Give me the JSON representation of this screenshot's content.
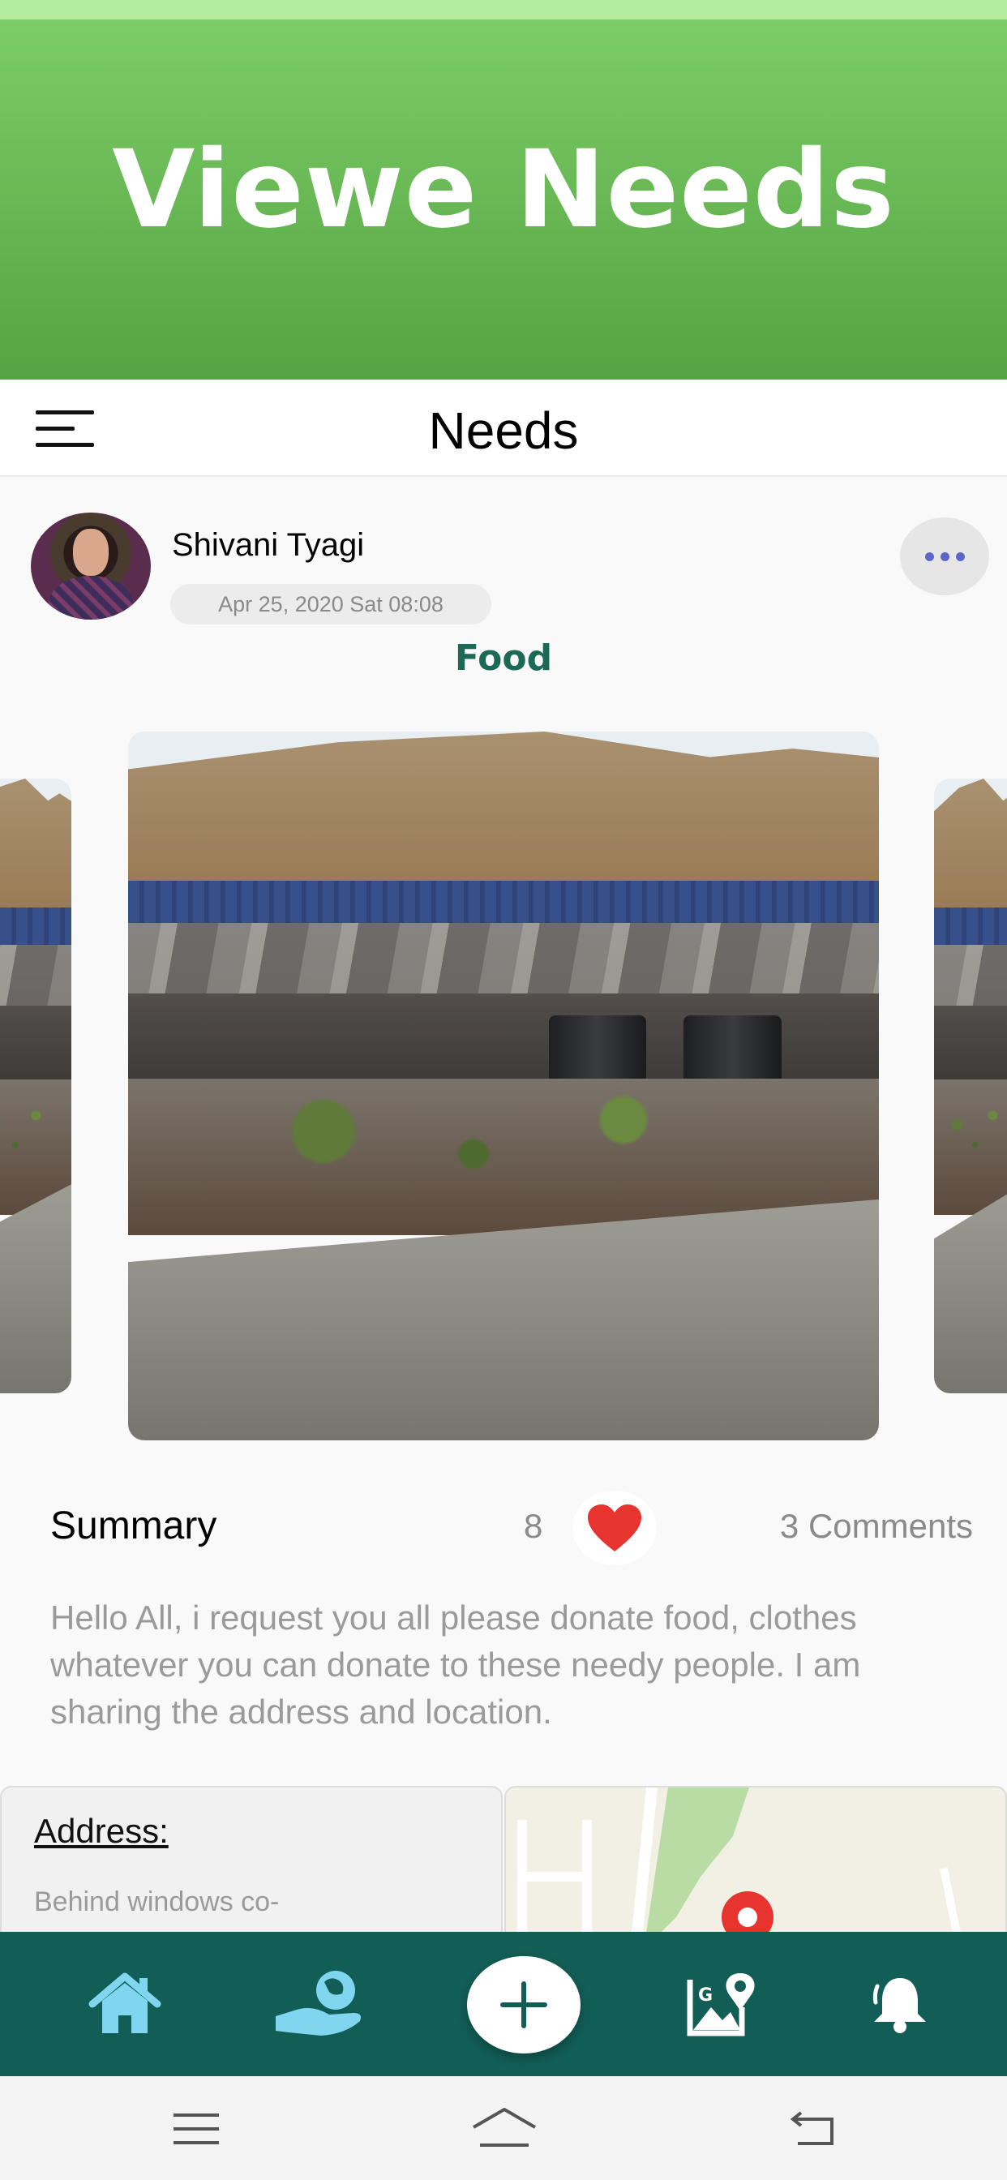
{
  "banner": {
    "title": "Viewe Needs"
  },
  "header": {
    "title": "Needs"
  },
  "post": {
    "author": "Shivani Tyagi",
    "date": "Apr 25, 2020 Sat 08:08",
    "category": "Food",
    "summary_label": "Summary",
    "likes": "8",
    "comments": "3 Comments",
    "summary_text": "Hello All, i request you all please donate food, clothes whatever you can donate to these needy people. I am sharing the address and location.",
    "address_label": "Address:",
    "address_text": "Behind windows co-"
  },
  "colors": {
    "banner_green": "#6bbd57",
    "category_text": "#1c6a56",
    "nav_background": "#125d55",
    "nav_icon": "#7fd6ee",
    "like_heart": "#e8342f",
    "map_pin": "#e8342f",
    "more_dots": "#5b67c8"
  },
  "icons": {
    "menu": "hamburger-menu-icon",
    "more": "more-horizontal-icon",
    "like": "heart-icon",
    "nav": [
      "home-icon",
      "hand-globe-icon",
      "plus-icon",
      "map-location-icon",
      "bell-icon"
    ],
    "system": [
      "recent-apps-icon",
      "home-outline-icon",
      "back-icon"
    ]
  }
}
